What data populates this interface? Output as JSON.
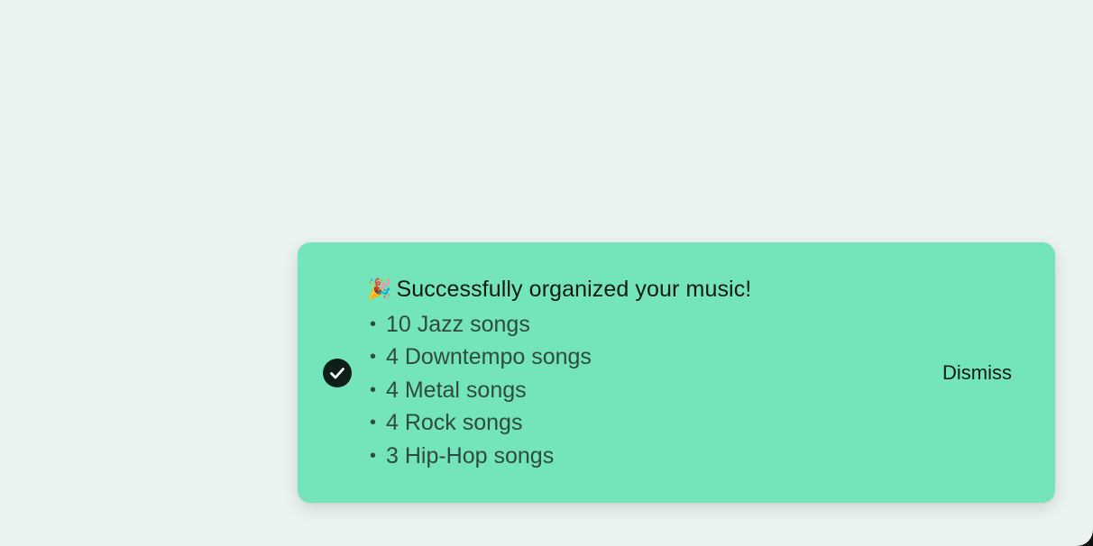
{
  "toast": {
    "status_icon": "check-circle-icon",
    "title_icon": "🎉",
    "title": "Successfully organized your music!",
    "items": [
      {
        "bullet": "•",
        "text": "10 Jazz songs"
      },
      {
        "bullet": "•",
        "text": "4 Downtempo songs"
      },
      {
        "bullet": "•",
        "text": "4 Metal songs"
      },
      {
        "bullet": "•",
        "text": "4 Rock songs"
      },
      {
        "bullet": "•",
        "text": "3 Hip-Hop songs"
      }
    ],
    "dismiss_label": "Dismiss"
  },
  "colors": {
    "page_background": "#ebf3f0",
    "toast_background": "#74e5bb",
    "icon_background": "#0d1f18",
    "title_text": "#0c1a14",
    "item_text": "#2f4a40"
  }
}
